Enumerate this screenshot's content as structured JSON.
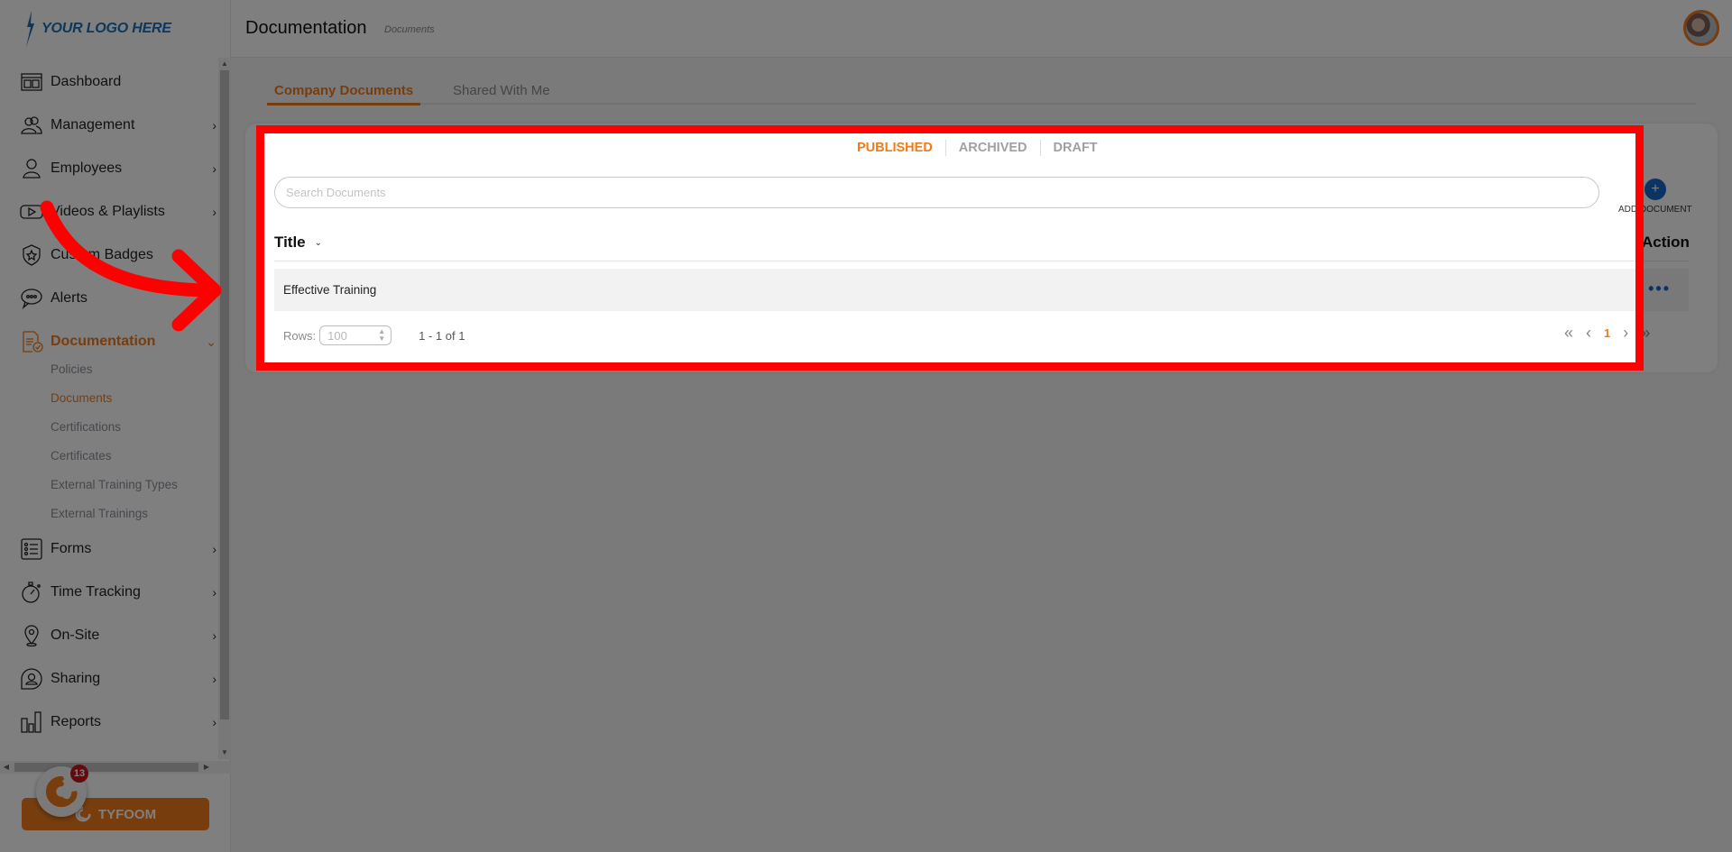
{
  "brand": {
    "logo_text": "YOUR LOGO HERE",
    "logo_color": "#1b6fb8",
    "accent_color": "#f07b1b",
    "link_color": "#1769c4"
  },
  "header": {
    "title": "Documentation",
    "breadcrumb": "Documents",
    "avatar_label": "user-avatar"
  },
  "sidebar": {
    "items": [
      {
        "label": "Dashboard",
        "icon": "dashboard-icon",
        "has_children": false
      },
      {
        "label": "Management",
        "icon": "management-icon",
        "has_children": true
      },
      {
        "label": "Employees",
        "icon": "employee-icon",
        "has_children": true
      },
      {
        "label": "Videos & Playlists",
        "icon": "video-icon",
        "has_children": true
      },
      {
        "label": "Custom Badges",
        "icon": "badge-icon",
        "has_children": false
      },
      {
        "label": "Alerts",
        "icon": "chat-bubble-icon",
        "has_children": false
      },
      {
        "label": "Documentation",
        "icon": "document-check-icon",
        "has_children": true,
        "expanded": true,
        "active": true
      },
      {
        "label": "Forms",
        "icon": "list-icon",
        "has_children": true
      },
      {
        "label": "Time Tracking",
        "icon": "stopwatch-icon",
        "has_children": true
      },
      {
        "label": "On-Site",
        "icon": "location-pin-icon",
        "has_children": true
      },
      {
        "label": "Sharing",
        "icon": "share-user-icon",
        "has_children": true
      },
      {
        "label": "Reports",
        "icon": "bar-chart-icon",
        "has_children": true
      }
    ],
    "sub_items": [
      {
        "label": "Policies",
        "active": false
      },
      {
        "label": "Documents",
        "active": true
      },
      {
        "label": "Certifications",
        "active": false
      },
      {
        "label": "Certificates",
        "active": false
      },
      {
        "label": "External Training Types",
        "active": false
      },
      {
        "label": "External Trainings",
        "active": false
      }
    ],
    "tyfoom_button": "TYFOOM",
    "notification_count": "13"
  },
  "main": {
    "tabs": [
      {
        "label": "Company Documents",
        "active": true
      },
      {
        "label": "Shared With Me",
        "active": false
      }
    ],
    "status_filters": [
      {
        "label": "PUBLISHED",
        "active": true
      },
      {
        "label": "ARCHIVED",
        "active": false
      },
      {
        "label": "DRAFT",
        "active": false
      }
    ],
    "search": {
      "placeholder": "Search Documents",
      "value": ""
    },
    "add_button": {
      "label": "ADD DOCUMENT",
      "icon": "plus-icon"
    },
    "table": {
      "columns": [
        "Title",
        "Action"
      ],
      "rows": [
        {
          "title": "Effective Training",
          "action": "•••"
        }
      ]
    },
    "pagination": {
      "rows_label": "Rows:",
      "rows_value": "100",
      "range": "1 - 1 of 1",
      "current_page": "1",
      "first": "«",
      "prev": "‹",
      "next": "›",
      "last": "»"
    }
  }
}
